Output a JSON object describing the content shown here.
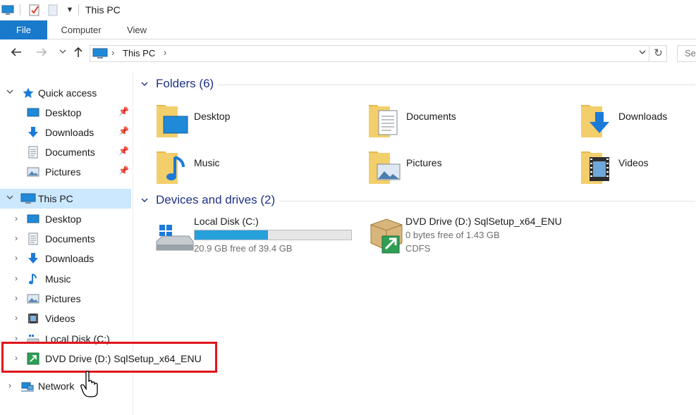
{
  "window": {
    "title": "This PC"
  },
  "ribbon": {
    "tabs": [
      "File",
      "Computer",
      "View"
    ]
  },
  "address_bar": {
    "path": "This PC",
    "search_placeholder": "Search This PC"
  },
  "nav_pane": {
    "quick_access": {
      "label": "Quick access",
      "items": [
        {
          "label": "Desktop",
          "icon": "desktop-icon",
          "pinned": true
        },
        {
          "label": "Downloads",
          "icon": "downloads-icon",
          "pinned": true
        },
        {
          "label": "Documents",
          "icon": "documents-icon",
          "pinned": true
        },
        {
          "label": "Pictures",
          "icon": "pictures-icon",
          "pinned": true
        }
      ]
    },
    "this_pc": {
      "label": "This PC",
      "items": [
        {
          "label": "Desktop",
          "icon": "desktop-icon"
        },
        {
          "label": "Documents",
          "icon": "documents-icon"
        },
        {
          "label": "Downloads",
          "icon": "downloads-icon"
        },
        {
          "label": "Music",
          "icon": "music-icon"
        },
        {
          "label": "Pictures",
          "icon": "pictures-icon"
        },
        {
          "label": "Videos",
          "icon": "videos-icon"
        },
        {
          "label": "Local Disk (C:)",
          "icon": "local-disk-icon"
        },
        {
          "label": "DVD Drive (D:) SqlSetup_x64_ENU",
          "icon": "dvd-drive-icon"
        }
      ]
    },
    "network": {
      "label": "Network"
    }
  },
  "content": {
    "folders": {
      "header": "Folders (6)",
      "items": [
        {
          "label": "Desktop",
          "icon": "desktop-folder-icon"
        },
        {
          "label": "Documents",
          "icon": "documents-folder-icon"
        },
        {
          "label": "Downloads",
          "icon": "downloads-folder-icon"
        },
        {
          "label": "Music",
          "icon": "music-folder-icon"
        },
        {
          "label": "Pictures",
          "icon": "pictures-folder-icon"
        },
        {
          "label": "Videos",
          "icon": "videos-folder-icon"
        }
      ]
    },
    "devices": {
      "header": "Devices and drives (2)",
      "items": [
        {
          "label": "Local Disk (C:)",
          "free_text": "20.9 GB free of 39.4 GB",
          "used_fraction": 0.47,
          "icon": "local-disk-icon"
        },
        {
          "label": "DVD Drive (D:) SqlSetup_x64_ENU",
          "free_text": "0 bytes free of 1.43 GB",
          "filesystem": "CDFS",
          "icon": "dvd-drive-icon"
        }
      ]
    }
  },
  "colors": {
    "accent": "#1979ca",
    "selection": "#cce8ff",
    "group_header": "#1e3287",
    "highlight": "#e0141b",
    "progress": "#26a0da"
  }
}
